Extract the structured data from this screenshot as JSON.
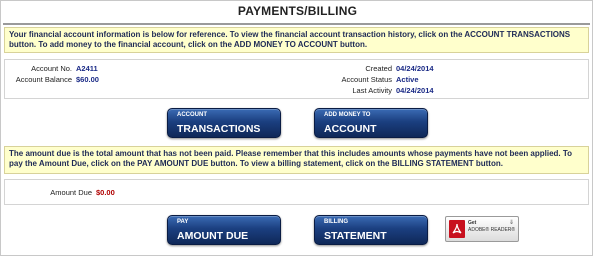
{
  "page": {
    "title": "PAYMENTS/BILLING"
  },
  "notice_account": "Your financial account information is below for reference. To view the financial account transaction history, click on the ACCOUNT TRANSACTIONS button. To add money to the financial account, click on the ADD MONEY TO ACCOUNT button.",
  "account": {
    "number_label": "Account No.",
    "number_value": "A2411",
    "balance_label": "Account Balance",
    "balance_value": "$60.00",
    "created_label": "Created",
    "created_value": "04/24/2014",
    "status_label": "Account Status",
    "status_value": "Active",
    "last_activity_label": "Last Activity",
    "last_activity_value": "04/24/2014"
  },
  "buttons": {
    "transactions_small": "ACCOUNT",
    "transactions_big": "TRANSACTIONS",
    "add_money_small": "ADD MONEY TO",
    "add_money_big": "ACCOUNT",
    "pay_small": "PAY",
    "pay_big": "AMOUNT DUE",
    "billing_small": "BILLING",
    "billing_big": "STATEMENT"
  },
  "notice_due": "The amount due is the total amount that has not been paid. Please remember that this includes amounts whose payments have not been applied. To pay the Amount Due, click on the PAY AMOUNT DUE button. To view a billing statement, click on the BILLING STATEMENT button.",
  "due": {
    "label": "Amount Due",
    "value": "$0.00"
  },
  "adobe": {
    "get": "Get",
    "reader": "ADOBE® READER®",
    "icon": "adobe-pdf-icon"
  },
  "colors": {
    "button": "#1b3f80",
    "notice_bg": "#ffffcc",
    "value_text": "#1a2a86",
    "due_value": "#b00000"
  }
}
